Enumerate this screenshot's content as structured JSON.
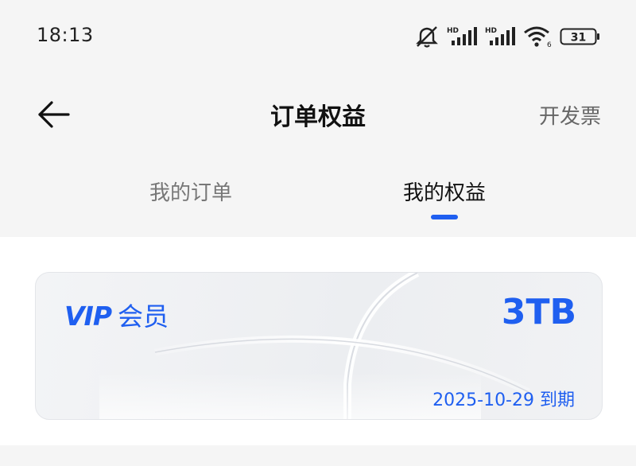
{
  "status_bar": {
    "time": "18:13",
    "icons": [
      "mute-icon",
      "hd-signal-icon",
      "hd-signal-icon",
      "wifi-icon",
      "battery-icon"
    ],
    "network_label_1": "HD",
    "network_label_2": "HD",
    "wifi_sub": "6",
    "battery": "31"
  },
  "nav": {
    "back_icon": "arrow-left-icon",
    "title": "订单权益",
    "invoice": "开发票"
  },
  "tabs": {
    "items": [
      {
        "label": "我的订单",
        "active": false
      },
      {
        "label": "我的权益",
        "active": true
      }
    ],
    "accent": "#1f5ff0"
  },
  "vip_card": {
    "logo": "VIP",
    "title": "会员",
    "capacity": "3TB",
    "expiry": "2025-10-29 到期",
    "accent": "#1f5ff0"
  }
}
